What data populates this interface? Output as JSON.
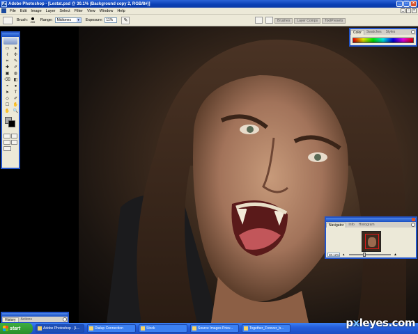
{
  "window": {
    "title": "Adobe Photoshop - [Lestat.psd @ 30.1% (Background copy 2, RGB/8#)]",
    "logo_text": "Ps"
  },
  "menu": {
    "items": [
      "File",
      "Edit",
      "Image",
      "Layer",
      "Select",
      "Filter",
      "View",
      "Window",
      "Help"
    ]
  },
  "options_bar": {
    "brush_label": "Brush:",
    "brush_size": "200",
    "range_label": "Range:",
    "range_value": "Midtones",
    "exposure_label": "Exposure:",
    "exposure_value": "11%",
    "well_tabs": [
      "Brushes",
      "Layer Comps",
      "ToolPresets"
    ]
  },
  "toolbox": {
    "tools": [
      "▭",
      "➤",
      "ℓ",
      "✣",
      "⌗",
      "✎",
      "✚",
      "✐",
      "▣",
      "◍",
      "⌫",
      "◧",
      "◓",
      "●",
      "➤",
      "T",
      "◇",
      "✐",
      "☐",
      "✋",
      "✋",
      "🔍"
    ],
    "foreground_color": "#a9a9a9",
    "background_color": "#000000"
  },
  "color_panel": {
    "tabs": [
      "Color",
      "Swatches",
      "Styles"
    ],
    "active_tab": "Color"
  },
  "navigator_panel": {
    "tabs": [
      "Navigator",
      "Info",
      "Histogram"
    ],
    "active_tab": "Navigator",
    "zoom_value": "30.12%"
  },
  "history_panel": {
    "tabs": [
      "History",
      "Actions"
    ],
    "active_tab": "History"
  },
  "taskbar": {
    "start_label": "start",
    "tasks": [
      "Adobe Photoshop - [L...",
      "Dialup Connection",
      "Stock",
      "Source Images Priev...",
      "Together_Forever_b..."
    ]
  },
  "watermark": {
    "text_pre": "p",
    "text_x": "x",
    "text_post": "leyes.com"
  }
}
